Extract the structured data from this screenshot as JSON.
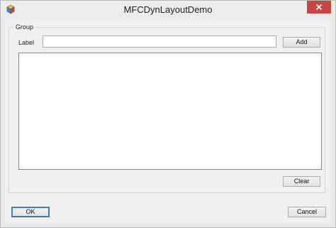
{
  "window": {
    "title": "MFCDynLayoutDemo",
    "icons": {
      "app": "mfc-app-icon",
      "close": "close-icon"
    },
    "colors": {
      "close_button": "#c7463f",
      "client_bg": "#f0f0f0",
      "default_button_border": "#3c7fb1"
    }
  },
  "group": {
    "label": "Group",
    "field_label": "Label",
    "input": {
      "value": "",
      "placeholder": ""
    },
    "add_label": "Add",
    "list_items": [],
    "clear_label": "Clear"
  },
  "footer": {
    "ok_label": "OK",
    "cancel_label": "Cancel"
  }
}
